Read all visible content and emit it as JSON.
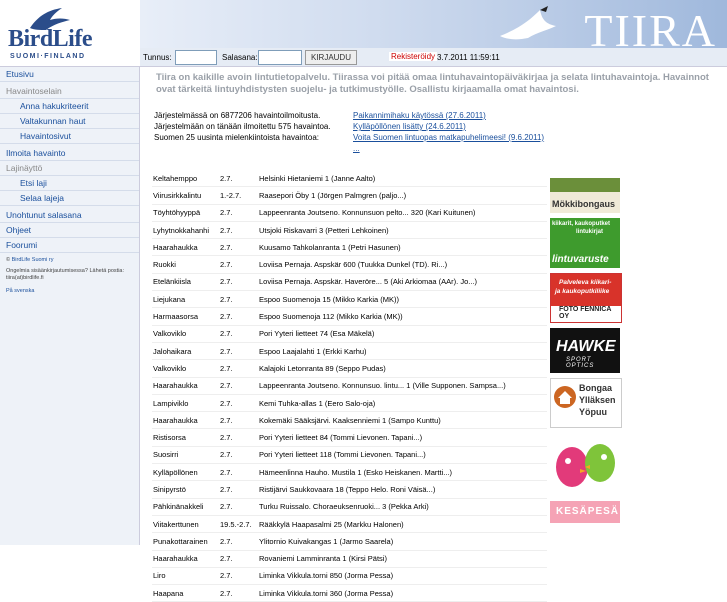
{
  "header": {
    "brand": "BirdLife",
    "brand_sub": "SUOMI·FINLAND",
    "site_title": "TIIRA",
    "login": {
      "username_label": "Tunnus:",
      "password_label": "Salasana:",
      "login_button": "KIRJAUDU",
      "register_link": "Rekisteröidy",
      "clock": "3.7.2011 11:59:11"
    }
  },
  "sidebar": {
    "items": [
      {
        "label": "Etusivu"
      },
      {
        "label": "Havaintoselain"
      },
      {
        "label": "Anna hakukriteerit"
      },
      {
        "label": "Valtakunnan haut"
      },
      {
        "label": "Havaintosivut"
      },
      {
        "label": "Ilmoita havainto"
      },
      {
        "label": "Lajinäyttö"
      },
      {
        "label": "Etsi laji"
      },
      {
        "label": "Selaa lajeja"
      },
      {
        "label": "Unohtunut salasana"
      },
      {
        "label": "Ohjeet"
      },
      {
        "label": "Foorumi"
      }
    ],
    "footer": {
      "copyright_prefix": "©",
      "copyright_link": "BirdLife Suomi ry",
      "info": "Ongelmia sisäänkirjautumisessa? Lähetä postia:",
      "email": "tiira(at)birdlife.fi",
      "lang": "På svenska"
    }
  },
  "main": {
    "intro": "Tiira on kaikille avoin lintutietopalvelu. Tiirassa voi pitää omaa lintuhavaintopäiväkirjaa ja selata lintuhavaintoja. Havainnot ovat tärkeitä lintuyhdistysten suojelu- ja tutkimustyölle. Osallistu kirjaamalla omat havaintosi.",
    "stats": [
      {
        "text": "Järjestelmässä on 6877206 havaintoilmoitusta.",
        "news": "Paikannimihaku käytössä (27.6.2011)"
      },
      {
        "text": "Järjestelmään on tänään ilmoitettu 575 havaintoa.",
        "news": "Kylläpöllönen lisätty (24.6.2011)"
      },
      {
        "text": "Suomen 25 uusinta mielenkiintoista havaintoa:",
        "news": "Voita Suomen lintuopas matkapuhelimeesi! (9.6.2011)"
      },
      {
        "text": "",
        "news": "..."
      }
    ],
    "observations": [
      {
        "species": "Keltahemppo",
        "date": "2.7.",
        "place": "Helsinki Hietaniemi 1 (Janne Aalto)"
      },
      {
        "species": "Viirusirkkalintu",
        "date": "1.-2.7.",
        "place": "Raasepori Öby 1 (Jörgen Palmgren (paljo...)"
      },
      {
        "species": "Töyhtöhyyppä",
        "date": "2.7.",
        "place": "Lappeenranta Joutseno. Konnunsuon pelto... 320 (Kari Kuitunen)"
      },
      {
        "species": "Lyhytnokkahanhi",
        "date": "2.7.",
        "place": "Utsjoki Riskavarri 3 (Petteri Lehkoinen)"
      },
      {
        "species": "Haarahaukka",
        "date": "2.7.",
        "place": "Kuusamo Tahkolanranta 1 (Petri Hasunen)"
      },
      {
        "species": "Ruokki",
        "date": "2.7.",
        "place": "Loviisa Pernaja. Aspskär 600 (Tuukka Dunkel (TD). Ri...)"
      },
      {
        "species": "Etelänkiisla",
        "date": "2.7.",
        "place": "Loviisa Pernaja. Aspskär. Haverörе... 5 (Aki Arkiomaa (AAr). Jo...)"
      },
      {
        "species": "Liejukana",
        "date": "2.7.",
        "place": "Espoo Suomenoja 15 (Mikko Karkia (MK))"
      },
      {
        "species": "Harmaasorsa",
        "date": "2.7.",
        "place": "Espoo Suomenoja 112 (Mikko Karkia (MK))"
      },
      {
        "species": "Valkoviklo",
        "date": "2.7.",
        "place": "Pori Yyteri lietteet 74 (Esa Mäkelä)"
      },
      {
        "species": "Jalohaikara",
        "date": "2.7.",
        "place": "Espoo Laajalahti 1 (Erkki Karhu)"
      },
      {
        "species": "Valkoviklo",
        "date": "2.7.",
        "place": "Kalajoki Letonranta 89 (Seppo Pudas)"
      },
      {
        "species": "Haarahaukka",
        "date": "2.7.",
        "place": "Lappeenranta Joutseno. Konnunsuo. lintu... 1 (Ville Supponen. Sampsa...)"
      },
      {
        "species": "Lampiviklo",
        "date": "2.7.",
        "place": "Kemi Tuhka-allas 1 (Eero Salo-oja)"
      },
      {
        "species": "Haarahaukka",
        "date": "2.7.",
        "place": "Kokemäki Sääksjärvi. Kaaksenniemi 1 (Sampo Kunttu)"
      },
      {
        "species": "Ristisorsa",
        "date": "2.7.",
        "place": "Pori Yyteri lietteet 84 (Tommi Lievonen. Tapani...)"
      },
      {
        "species": "Suosirri",
        "date": "2.7.",
        "place": "Pori Yyteri lietteet 118 (Tommi Lievonen. Tapani...)"
      },
      {
        "species": "Kylläpöllönen",
        "date": "2.7.",
        "place": "Hämeenlinna Hauho. Mustila 1 (Esko Heiskanen. Martti...)"
      },
      {
        "species": "Sinipyrstö",
        "date": "2.7.",
        "place": "Ristijärvi Saukkovaara 18 (Teppo Helo. Roni Väisä...)"
      },
      {
        "species": "Pähkinänakkeli",
        "date": "2.7.",
        "place": "Turku Ruissalo. Choraeuksenruoki... 3 (Pekka Arki)"
      },
      {
        "species": "Viitakerttunen",
        "date": "19.5.-2.7.",
        "place": "Rääkkylä Haapasalmi 25 (Markku Halonen)"
      },
      {
        "species": "Punakottarainen",
        "date": "2.7.",
        "place": "Ylitornio Kuivakangas 1 (Jarmo Saarela)"
      },
      {
        "species": "Haarahaukka",
        "date": "2.7.",
        "place": "Rovaniemi Lamminranta 1 (Kirsi Pätsi)"
      },
      {
        "species": "Liro",
        "date": "2.7.",
        "place": "Liminka Vikkula.torni 850 (Jorma Pessa)"
      },
      {
        "species": "Haapana",
        "date": "2.7.",
        "place": "Liminka Vikkula.torni 360 (Jorma Pessa)"
      }
    ]
  },
  "ads": [
    {
      "name": "mokkibongaus",
      "text": "Mökkibongaus"
    },
    {
      "name": "lintuvaruste",
      "line1": "kiikarit, kaukoputket",
      "line2": "lintukirjat",
      "brand": "lintuvaruste"
    },
    {
      "name": "foto-fennica",
      "line1": "Palveleva kiikari-",
      "line2": "ja kaukoputkiliike",
      "brand": "FOTO FENNICA OY"
    },
    {
      "name": "hawke",
      "brand": "HAWKE",
      "sub": "SPORT OPTICS"
    },
    {
      "name": "bongaa",
      "line1": "Bongaa",
      "line2": "Ylläksen",
      "line3": "Yöpuu"
    },
    {
      "name": "kesapesa",
      "brand": "KESÄPESÄ"
    }
  ],
  "colors": {
    "link": "#1a4f9c",
    "register": "#cc0000",
    "sidebar_bg": "#eef2f8",
    "intro_text": "#9aa0a8"
  }
}
